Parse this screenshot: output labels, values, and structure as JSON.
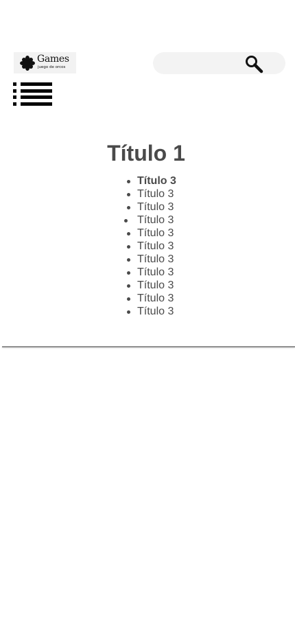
{
  "header": {
    "logo": {
      "name": "Games",
      "tagline": "juego de orcos",
      "icon": "flower-badge-icon"
    },
    "search": {
      "placeholder": "",
      "icon": "search-icon"
    },
    "menu_icon": "list-menu-icon"
  },
  "main": {
    "title": "Título 1",
    "items": [
      "Título 3",
      "Título 3",
      "Título 3",
      "Título 3",
      "Título 3",
      "Título 3",
      "Título 3",
      "Título 3",
      "Título 3",
      "Título 3",
      "Título 3"
    ]
  },
  "colors": {
    "text": "#4a4a4a",
    "search_bg": "#f3f3f3",
    "logo_bg": "#f2f2f2",
    "divider": "#8f8f8f"
  }
}
